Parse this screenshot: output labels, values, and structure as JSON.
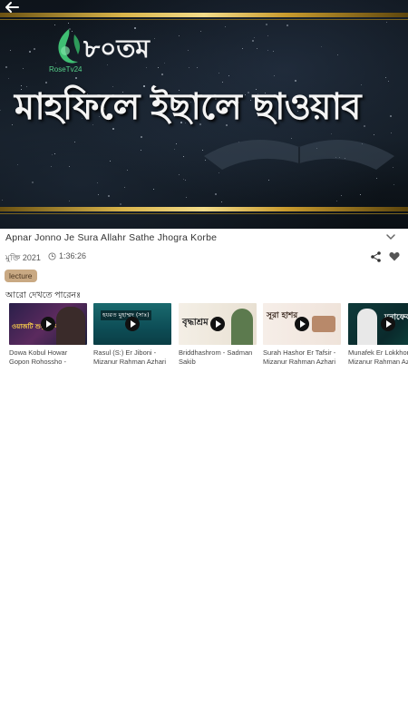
{
  "player": {
    "logo_text": "RoseTv24",
    "overlay_number": "৮০তম",
    "overlay_title": "মাহফিলে ইছালে ছাওয়াব"
  },
  "video": {
    "title": "Apnar Jonno Je Sura Allahr Sathe Jhogra Korbe",
    "date": "মুক্তি 2021",
    "duration": "1:36:26",
    "tag": "lecture"
  },
  "related": {
    "heading": "আরো দেখতে পারেনঃ",
    "items": [
      {
        "title": "Dowa Kobul Howar Gopon Rohossho -",
        "thumb_caption": "ওয়াজটি শুনুন সবাই"
      },
      {
        "title": "Rasul (S:) Er Jiboni - Mizanur Rahman Azhari",
        "thumb_caption": "হযরত মুহাম্মদ (সাঃ)"
      },
      {
        "title": "Briddhashrom - Sadman Sakib",
        "thumb_caption": "বৃদ্ধাশ্রম"
      },
      {
        "title": "Surah Hashor Er Tafsir - Mizanur Rahman Azhari",
        "thumb_caption": "সূরা হাশর"
      },
      {
        "title": "Munafek Er Lokkhon - Mizanur Rahman Azhari",
        "thumb_caption": "মুনাফেক"
      }
    ]
  },
  "colors": {
    "tag_bg": "#c9a983",
    "gold": "#d9b44a",
    "logo_green": "#56d18a"
  },
  "icons": [
    "back-arrow-icon",
    "chevron-down-icon",
    "clock-icon",
    "share-icon",
    "heart-icon",
    "play-icon"
  ]
}
